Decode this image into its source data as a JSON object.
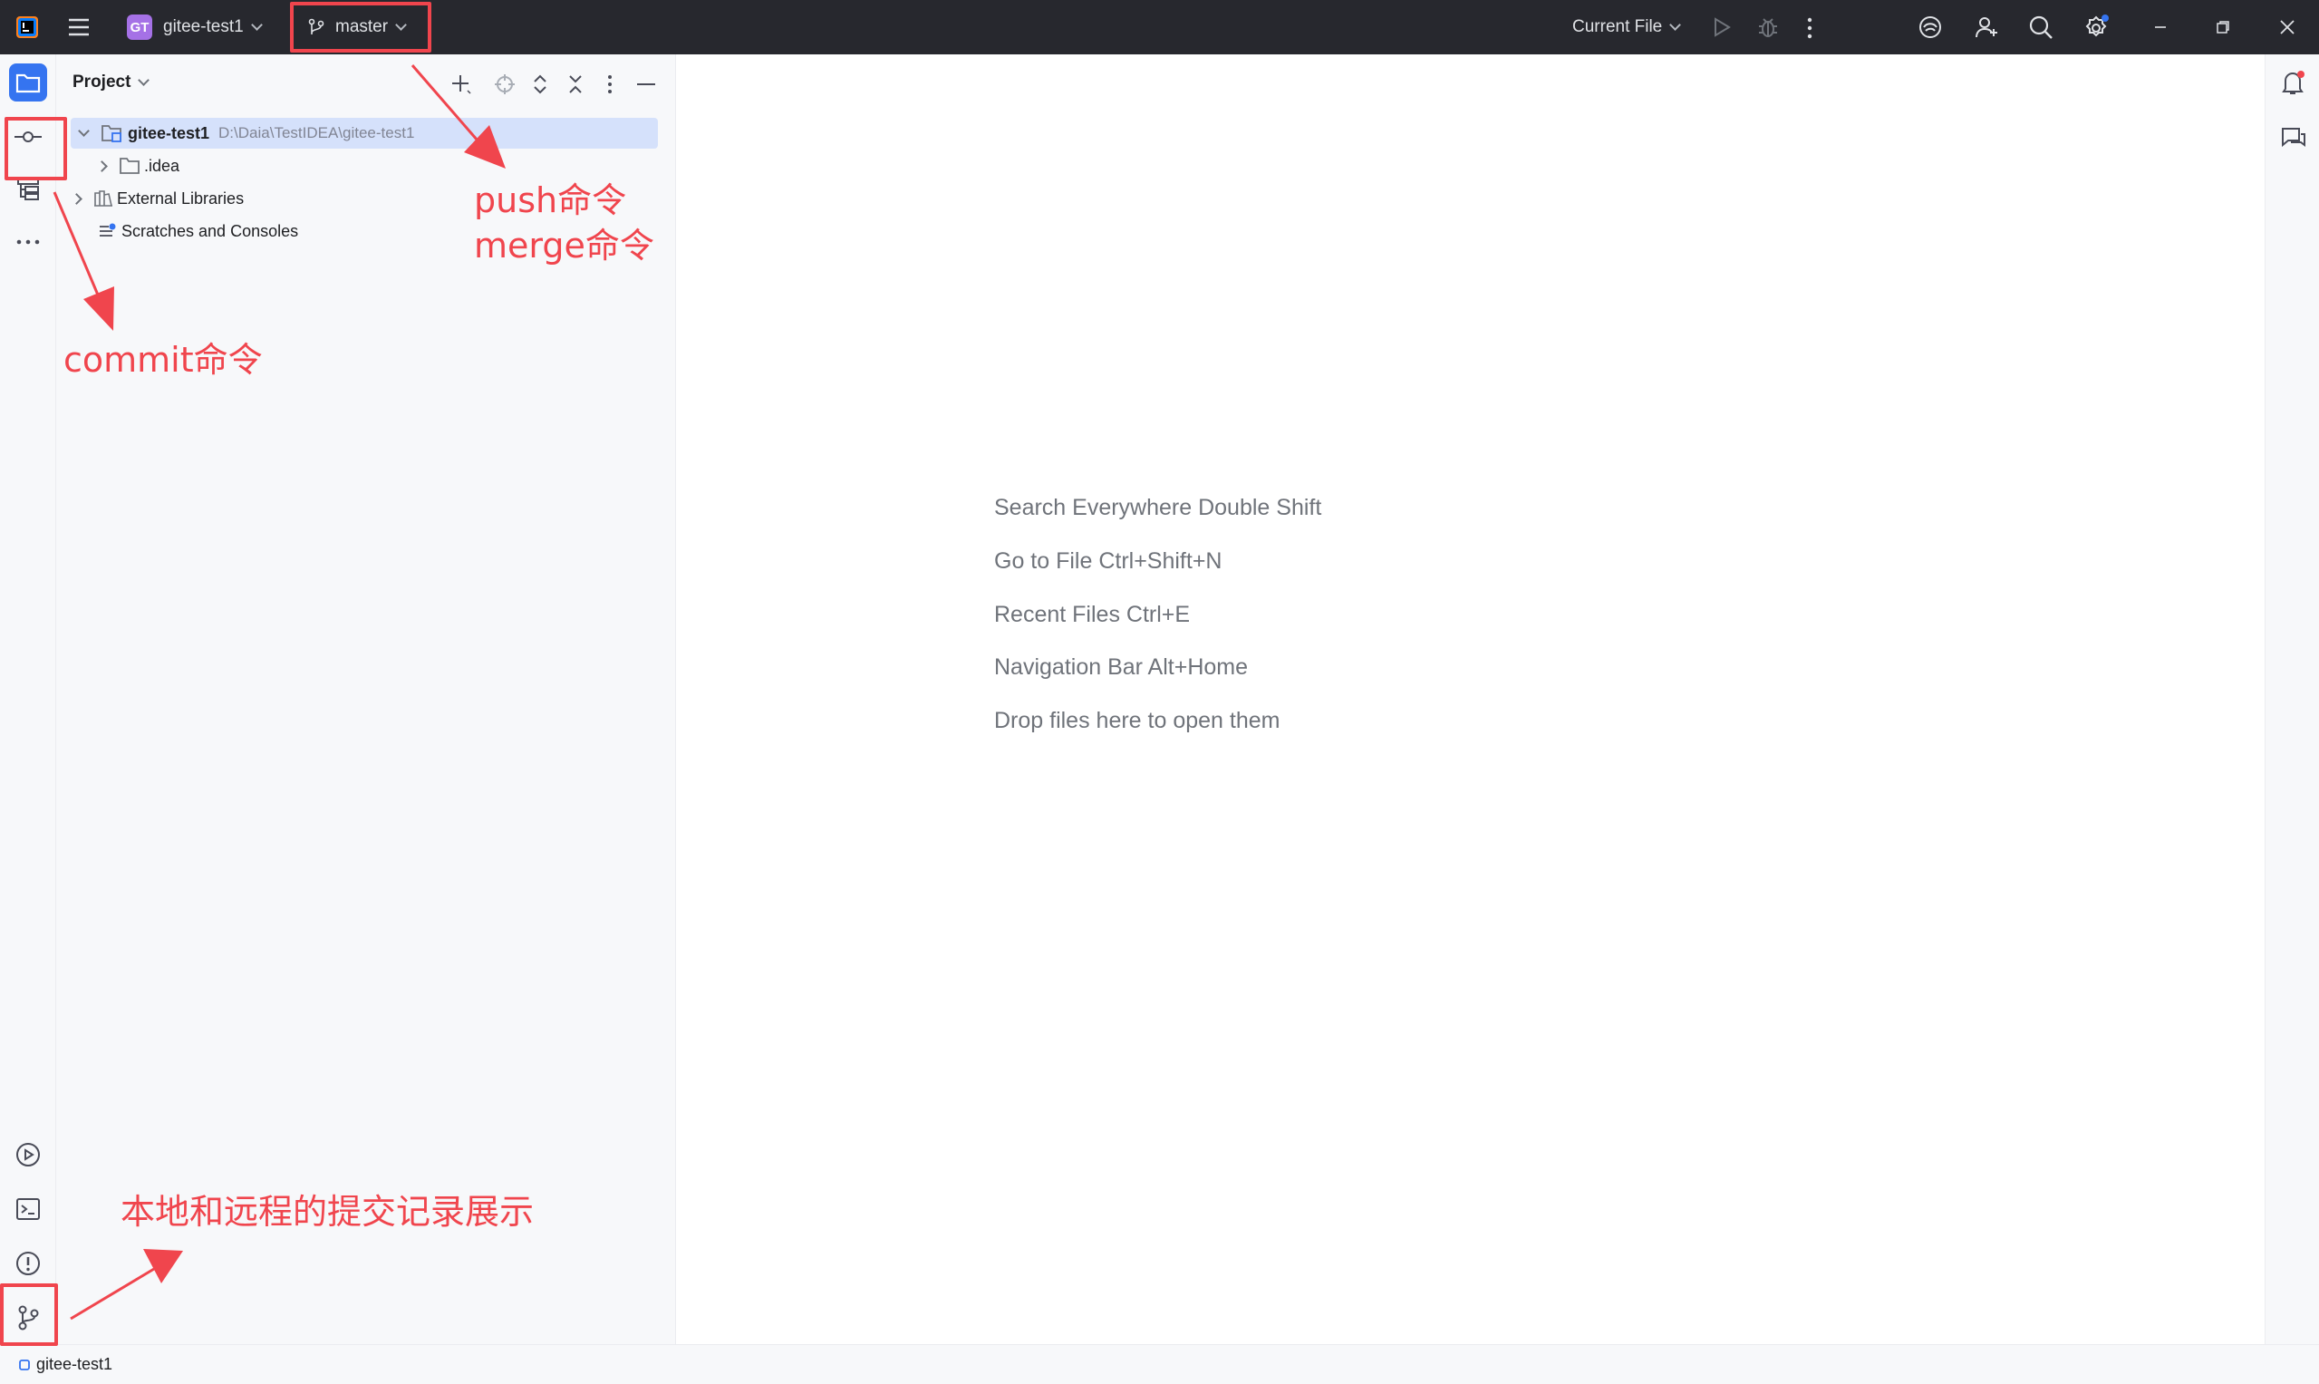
{
  "titlebar": {
    "project_badge": "GT",
    "project_name": "gitee-test1",
    "branch": "master",
    "run_config": "Current File"
  },
  "project_panel": {
    "title": "Project",
    "tree": [
      {
        "label": "gitee-test1",
        "path": "D:\\Daia\\TestIDEA\\gitee-test1"
      },
      {
        "label": ".idea"
      },
      {
        "label": "External Libraries"
      },
      {
        "label": "Scratches and Consoles"
      }
    ]
  },
  "editor": {
    "hints": [
      "Search Everywhere Double Shift",
      "Go to File Ctrl+Shift+N",
      "Recent Files Ctrl+E",
      "Navigation Bar Alt+Home",
      "Drop files here to open them"
    ]
  },
  "statusbar": {
    "project": "gitee-test1"
  },
  "annotations": {
    "push_label": "push命令",
    "merge_label": "merge命令",
    "commit_label": "commit命令",
    "log_label": "本地和远程的提交记录展示"
  },
  "colors": {
    "titlebar_bg": "#27282e",
    "accent": "#3574f0",
    "annotation": "#f0454d",
    "selection": "#d5e1fb"
  }
}
